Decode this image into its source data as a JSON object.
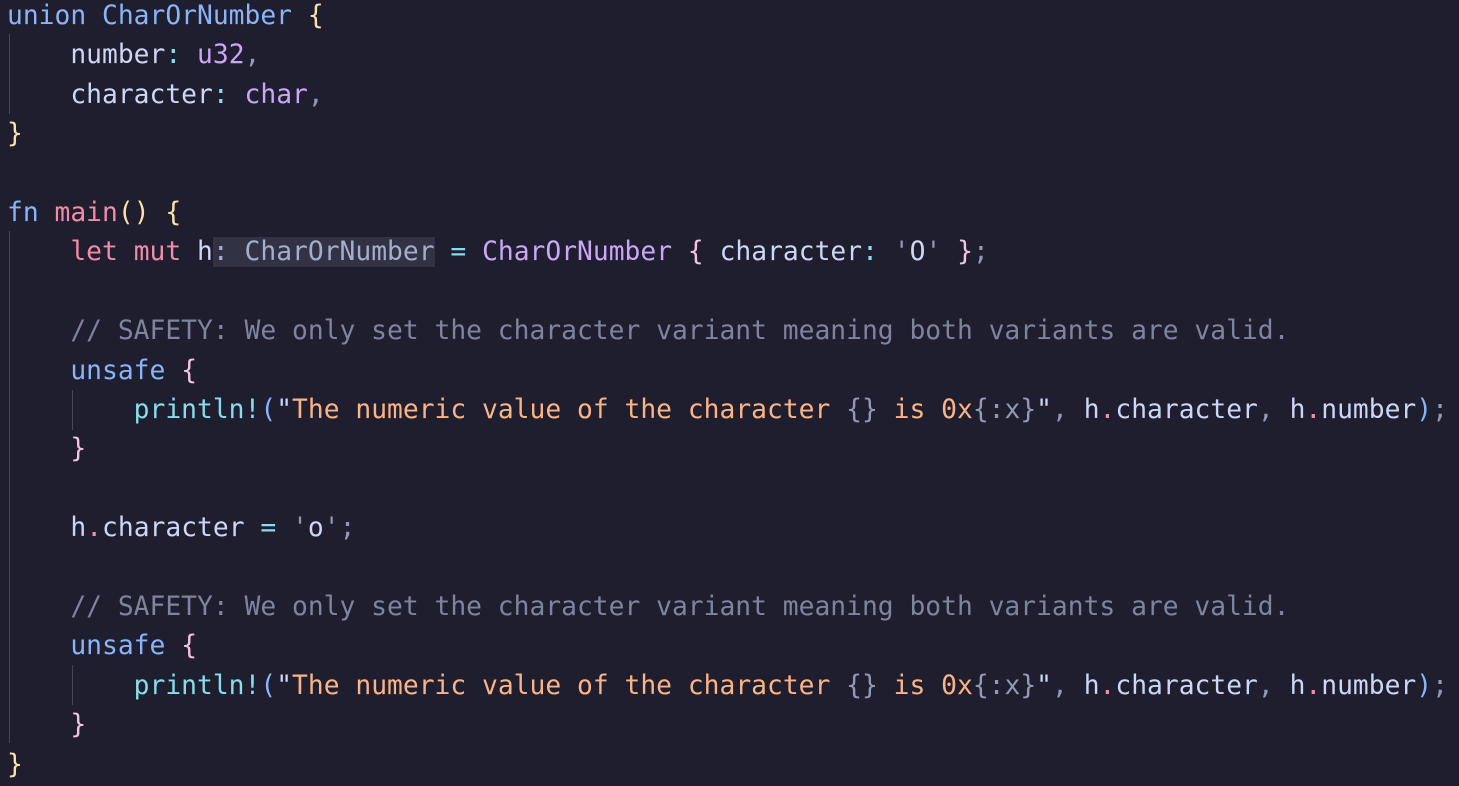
{
  "lines": [
    [
      {
        "t": "union",
        "c": "kw-blue"
      },
      {
        "t": " ",
        "c": "ident"
      },
      {
        "t": "CharOrNumber",
        "c": "fn-name"
      },
      {
        "t": " ",
        "c": "ident"
      },
      {
        "t": "{",
        "c": "brace-y"
      }
    ],
    [
      {
        "t": "    ",
        "c": "ident"
      },
      {
        "t": "number",
        "c": "ident"
      },
      {
        "t": ":",
        "c": "op"
      },
      {
        "t": " ",
        "c": "ident"
      },
      {
        "t": "u32",
        "c": "type-lav"
      },
      {
        "t": ",",
        "c": "punct"
      }
    ],
    [
      {
        "t": "    ",
        "c": "ident"
      },
      {
        "t": "character",
        "c": "ident"
      },
      {
        "t": ":",
        "c": "op"
      },
      {
        "t": " ",
        "c": "ident"
      },
      {
        "t": "char",
        "c": "type-lav"
      },
      {
        "t": ",",
        "c": "punct"
      }
    ],
    [
      {
        "t": "}",
        "c": "brace-y"
      }
    ],
    [],
    [
      {
        "t": "fn",
        "c": "kw-blue"
      },
      {
        "t": " ",
        "c": "ident"
      },
      {
        "t": "main",
        "c": "kw-pink"
      },
      {
        "t": "()",
        "c": "brace-y"
      },
      {
        "t": " ",
        "c": "ident"
      },
      {
        "t": "{",
        "c": "brace-y"
      }
    ],
    [
      {
        "t": "    ",
        "c": "ident"
      },
      {
        "t": "let",
        "c": "kw-pink"
      },
      {
        "t": " ",
        "c": "ident"
      },
      {
        "t": "mut",
        "c": "kw-pink"
      },
      {
        "t": " ",
        "c": "ident"
      },
      {
        "t": "h",
        "c": "ident"
      },
      {
        "t": ": CharOrNumber",
        "c": "hint"
      },
      {
        "t": " ",
        "c": "ident"
      },
      {
        "t": "=",
        "c": "op"
      },
      {
        "t": " ",
        "c": "ident"
      },
      {
        "t": "CharOrNumber",
        "c": "type-lav"
      },
      {
        "t": " ",
        "c": "ident"
      },
      {
        "t": "{",
        "c": "brace-p"
      },
      {
        "t": " ",
        "c": "ident"
      },
      {
        "t": "character",
        "c": "ident"
      },
      {
        "t": ":",
        "c": "op"
      },
      {
        "t": " ",
        "c": "ident"
      },
      {
        "t": "'",
        "c": "punct"
      },
      {
        "t": "O",
        "c": "ident"
      },
      {
        "t": "'",
        "c": "punct"
      },
      {
        "t": " ",
        "c": "ident"
      },
      {
        "t": "}",
        "c": "brace-p"
      },
      {
        "t": ";",
        "c": "punct"
      }
    ],
    [],
    [
      {
        "t": "    ",
        "c": "ident"
      },
      {
        "t": "// SAFETY: We only set the character variant meaning both variants are valid.",
        "c": "comment"
      }
    ],
    [
      {
        "t": "    ",
        "c": "ident"
      },
      {
        "t": "unsafe",
        "c": "kw-blue"
      },
      {
        "t": " ",
        "c": "ident"
      },
      {
        "t": "{",
        "c": "brace-p"
      }
    ],
    [
      {
        "t": "        ",
        "c": "ident"
      },
      {
        "t": "println!",
        "c": "macro"
      },
      {
        "t": "(",
        "c": "brace-b"
      },
      {
        "t": "\"",
        "c": "ident"
      },
      {
        "t": "The numeric value of the character ",
        "c": "strc"
      },
      {
        "t": "{}",
        "c": "punct"
      },
      {
        "t": " is 0x",
        "c": "strc"
      },
      {
        "t": "{:x}",
        "c": "punct"
      },
      {
        "t": "\"",
        "c": "ident"
      },
      {
        "t": ",",
        "c": "punct"
      },
      {
        "t": " ",
        "c": "ident"
      },
      {
        "t": "h",
        "c": "ident"
      },
      {
        "t": ".",
        "c": "kw-pink"
      },
      {
        "t": "character",
        "c": "ident"
      },
      {
        "t": ",",
        "c": "punct"
      },
      {
        "t": " ",
        "c": "ident"
      },
      {
        "t": "h",
        "c": "ident"
      },
      {
        "t": ".",
        "c": "kw-pink"
      },
      {
        "t": "number",
        "c": "ident"
      },
      {
        "t": ")",
        "c": "brace-b"
      },
      {
        "t": ";",
        "c": "punct"
      }
    ],
    [
      {
        "t": "    ",
        "c": "ident"
      },
      {
        "t": "}",
        "c": "brace-p"
      }
    ],
    [],
    [
      {
        "t": "    ",
        "c": "ident"
      },
      {
        "t": "h",
        "c": "ident"
      },
      {
        "t": ".",
        "c": "kw-pink"
      },
      {
        "t": "character",
        "c": "ident"
      },
      {
        "t": " ",
        "c": "ident"
      },
      {
        "t": "=",
        "c": "op"
      },
      {
        "t": " ",
        "c": "ident"
      },
      {
        "t": "'",
        "c": "punct"
      },
      {
        "t": "o",
        "c": "ident"
      },
      {
        "t": "'",
        "c": "punct"
      },
      {
        "t": ";",
        "c": "punct"
      }
    ],
    [],
    [
      {
        "t": "    ",
        "c": "ident"
      },
      {
        "t": "// SAFETY: We only set the character variant meaning both variants are valid.",
        "c": "comment"
      }
    ],
    [
      {
        "t": "    ",
        "c": "ident"
      },
      {
        "t": "unsafe",
        "c": "kw-blue"
      },
      {
        "t": " ",
        "c": "ident"
      },
      {
        "t": "{",
        "c": "brace-p"
      }
    ],
    [
      {
        "t": "        ",
        "c": "ident"
      },
      {
        "t": "println!",
        "c": "macro"
      },
      {
        "t": "(",
        "c": "brace-b"
      },
      {
        "t": "\"",
        "c": "ident"
      },
      {
        "t": "The numeric value of the character ",
        "c": "strc"
      },
      {
        "t": "{}",
        "c": "punct"
      },
      {
        "t": " is 0x",
        "c": "strc"
      },
      {
        "t": "{:x}",
        "c": "punct"
      },
      {
        "t": "\"",
        "c": "ident"
      },
      {
        "t": ",",
        "c": "punct"
      },
      {
        "t": " ",
        "c": "ident"
      },
      {
        "t": "h",
        "c": "ident"
      },
      {
        "t": ".",
        "c": "kw-pink"
      },
      {
        "t": "character",
        "c": "ident"
      },
      {
        "t": ",",
        "c": "punct"
      },
      {
        "t": " ",
        "c": "ident"
      },
      {
        "t": "h",
        "c": "ident"
      },
      {
        "t": ".",
        "c": "kw-pink"
      },
      {
        "t": "number",
        "c": "ident"
      },
      {
        "t": ")",
        "c": "brace-b"
      },
      {
        "t": ";",
        "c": "punct"
      }
    ],
    [
      {
        "t": "    ",
        "c": "ident"
      },
      {
        "t": "}",
        "c": "brace-p"
      }
    ],
    [
      {
        "t": "}",
        "c": "brace-y"
      }
    ]
  ]
}
